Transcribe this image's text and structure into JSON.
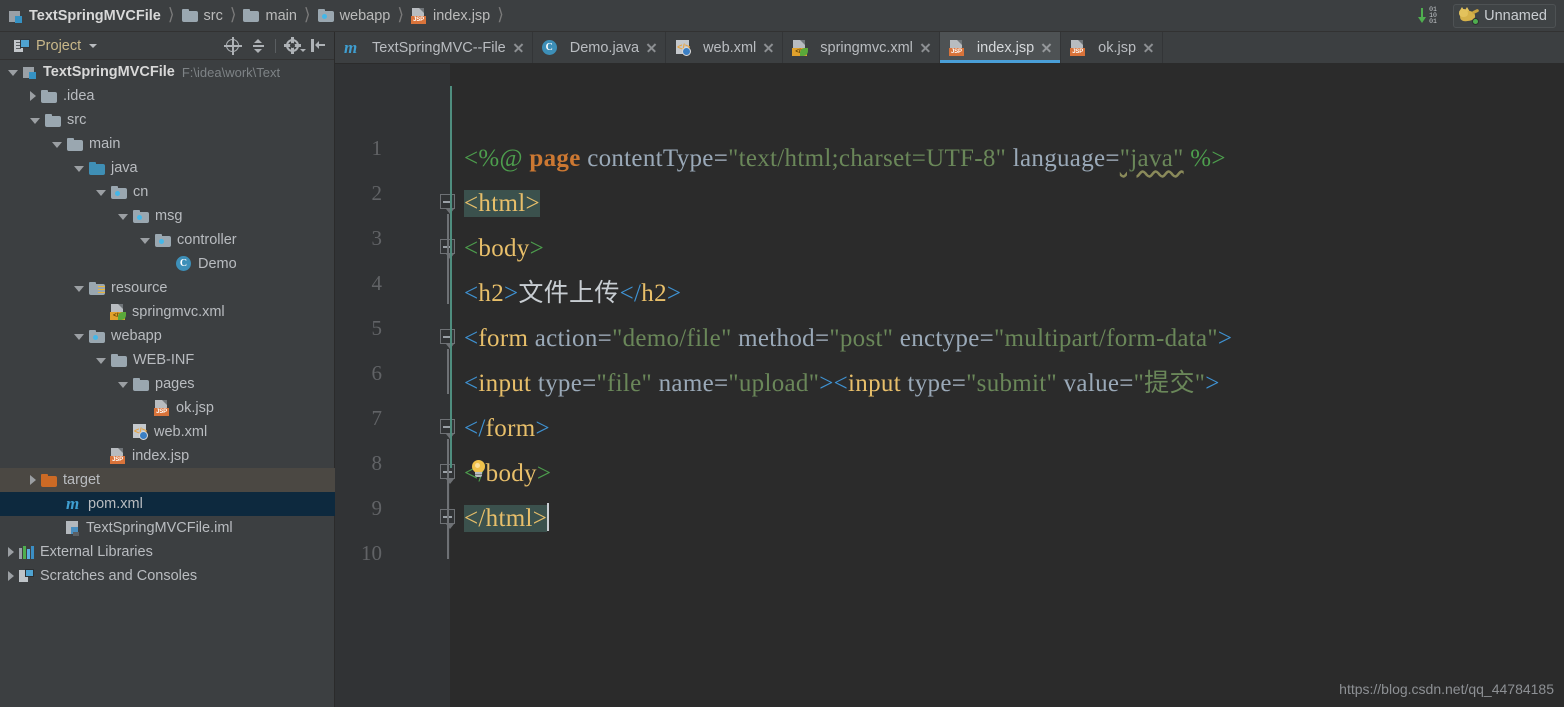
{
  "breadcrumb": {
    "items": [
      {
        "label": "TextSpringMVCFile",
        "icon": "module-icon",
        "root": true
      },
      {
        "label": "src",
        "icon": "folder-icon"
      },
      {
        "label": "main",
        "icon": "folder-icon"
      },
      {
        "label": "webapp",
        "icon": "folder-web-icon"
      },
      {
        "label": "index.jsp",
        "icon": "jsp-file-icon"
      }
    ]
  },
  "topright": {
    "download_icon": "download-binary-icon",
    "run_config": {
      "label": "Unnamed",
      "icon": "tomcat-cat-icon"
    }
  },
  "project_panel": {
    "title": "Project",
    "tools": [
      {
        "name": "locate-target-icon"
      },
      {
        "name": "collapse-all-icon"
      },
      {
        "name": "settings-gear-icon"
      },
      {
        "name": "hide-panel-icon"
      }
    ],
    "tree": [
      {
        "label": "TextSpringMVCFile",
        "path": "F:\\idea\\work\\Text",
        "indent": 0,
        "arrow": "down",
        "icon": "module-icon",
        "bold": true
      },
      {
        "label": ".idea",
        "indent": 1,
        "arrow": "right",
        "icon": "folder-icon"
      },
      {
        "label": "src",
        "indent": 1,
        "arrow": "down",
        "icon": "folder-icon"
      },
      {
        "label": "main",
        "indent": 2,
        "arrow": "down",
        "icon": "folder-icon"
      },
      {
        "label": "java",
        "indent": 3,
        "arrow": "down",
        "icon": "folder-source-icon"
      },
      {
        "label": "cn",
        "indent": 4,
        "arrow": "down",
        "icon": "folder-package-icon"
      },
      {
        "label": "msg",
        "indent": 5,
        "arrow": "down",
        "icon": "folder-package-icon"
      },
      {
        "label": "controller",
        "indent": 6,
        "arrow": "down",
        "icon": "folder-package-icon"
      },
      {
        "label": "Demo",
        "indent": 7,
        "arrow": "none",
        "icon": "java-class-icon"
      },
      {
        "label": "resource",
        "indent": 3,
        "arrow": "down",
        "icon": "folder-resource-icon"
      },
      {
        "label": "springmvc.xml",
        "indent": 4,
        "arrow": "none",
        "icon": "spring-xml-icon"
      },
      {
        "label": "webapp",
        "indent": 3,
        "arrow": "down",
        "icon": "folder-web-icon"
      },
      {
        "label": "WEB-INF",
        "indent": 4,
        "arrow": "down",
        "icon": "folder-icon"
      },
      {
        "label": "pages",
        "indent": 5,
        "arrow": "down",
        "icon": "folder-icon"
      },
      {
        "label": "ok.jsp",
        "indent": 6,
        "arrow": "none",
        "icon": "jsp-file-icon"
      },
      {
        "label": "web.xml",
        "indent": 5,
        "arrow": "none",
        "icon": "web-xml-icon"
      },
      {
        "label": "index.jsp",
        "indent": 4,
        "arrow": "none",
        "icon": "jsp-file-icon"
      },
      {
        "label": "target",
        "indent": 1,
        "arrow": "right",
        "icon": "folder-target-icon",
        "state": "hover"
      },
      {
        "label": "pom.xml",
        "indent": 2,
        "arrow": "none",
        "icon": "maven-icon",
        "state": "selected"
      },
      {
        "label": "TextSpringMVCFile.iml",
        "indent": 2,
        "arrow": "none",
        "icon": "iml-file-icon"
      },
      {
        "label": "External Libraries",
        "indent": 0,
        "arrow": "right",
        "icon": "libraries-icon"
      },
      {
        "label": "Scratches and Consoles",
        "indent": 0,
        "arrow": "right",
        "icon": "scratches-icon"
      }
    ]
  },
  "editor_tabs": [
    {
      "label": "TextSpringMVC--File",
      "icon": "maven-icon",
      "active": false,
      "closable": true
    },
    {
      "label": "Demo.java",
      "icon": "java-class-icon",
      "active": false,
      "closable": true
    },
    {
      "label": "web.xml",
      "icon": "web-xml-icon",
      "active": false,
      "closable": true
    },
    {
      "label": "springmvc.xml",
      "icon": "spring-xml-icon",
      "active": false,
      "closable": true
    },
    {
      "label": "index.jsp",
      "icon": "jsp-file-icon",
      "active": true,
      "closable": true
    },
    {
      "label": "ok.jsp",
      "icon": "jsp-file-icon",
      "active": false,
      "closable": true
    }
  ],
  "editor": {
    "line_numbers": [
      "1",
      "2",
      "3",
      "4",
      "5",
      "6",
      "7",
      "8",
      "9",
      "10"
    ],
    "code_lines": [
      "<%@ page contentType=\"text/html;charset=UTF-8\" language=\"java\" %>",
      "<html>",
      "<body>",
      "<h2>文件上传</h2>",
      "<form action=\"demo/file\" method=\"post\" enctype=\"multipart/form-data\">",
      "<input type=\"file\" name=\"upload\"><input type=\"submit\" value=\"提交\">",
      "</form>",
      "</body>",
      "</html>",
      ""
    ],
    "cursor_line": 9,
    "intention_bulb_line": 8,
    "colors": {
      "background": "#2b2b2b",
      "gutter": "#313335",
      "string": "#6a8759",
      "keyword": "#cc7832",
      "tag": "#e8bf6a",
      "attribute": "#9aa9b8",
      "selection_highlight": "#3b514d",
      "accent": "#4a9fd8"
    }
  },
  "watermark": "https://blog.csdn.net/qq_44784185"
}
